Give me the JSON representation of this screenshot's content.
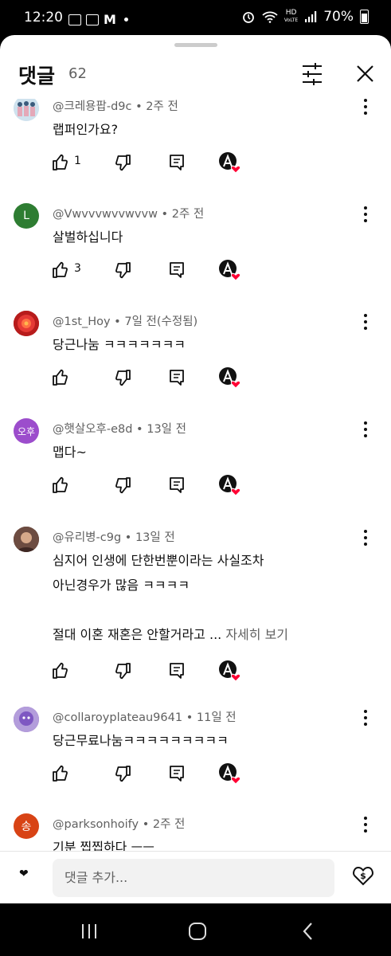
{
  "status_bar": {
    "time": "12:20",
    "battery": "70%",
    "hd_label": "HD",
    "volte_label": "VoLTE"
  },
  "header": {
    "title": "댓글",
    "count": "62"
  },
  "comments": [
    {
      "author": "@크레용팝-d9c",
      "sep": " • ",
      "time": "2주 전",
      "text": "랩퍼인가요?",
      "likes": "1",
      "avatar_letter": ""
    },
    {
      "author": "@Vwvvvwvvwvvw",
      "sep": " • ",
      "time": "2주 전",
      "text": "살벌하십니다",
      "likes": "3",
      "avatar_letter": "L",
      "avatar_color": "#2e7d32"
    },
    {
      "author": "@1st_Hoy",
      "sep": " • ",
      "time": "7일 전(수정됨)",
      "text": "당근나눔 ㅋㅋㅋㅋㅋㅋㅋ",
      "likes": "",
      "avatar_letter": ""
    },
    {
      "author": "@햇살오후-e8d",
      "sep": " • ",
      "time": "13일 전",
      "text": "맵다~",
      "likes": "",
      "avatar_letter": "오후",
      "avatar_color": "#9c4dcc"
    },
    {
      "author": "@유리병-c9g",
      "sep": " • ",
      "time": "13일 전",
      "text": "심지어 인생에 단한번뿐이라는 사실조차\n아닌경우가 많음 ㅋㅋㅋㅋ\n\n절대 이혼 재혼은 안할거라고 ...",
      "more": " 자세히 보기",
      "likes": "",
      "avatar_letter": ""
    },
    {
      "author": "@collaroyplateau9641",
      "sep": " • ",
      "time": "11일 전",
      "text": "당근무료나눔ㅋㅋㅋㅋㅋㅋㅋㅋㅋ",
      "likes": "",
      "avatar_letter": ""
    },
    {
      "author": "@parksonhoify",
      "sep": " • ",
      "time": "2주 전",
      "text": "기분 찝찝하다 ㅡㅡ",
      "likes": "",
      "avatar_letter": "송",
      "avatar_color": "#d84315"
    }
  ],
  "composer": {
    "placeholder": "댓글 추가...",
    "emoji": "❤"
  },
  "colors": {
    "heart": "#ff0033",
    "secondary_text": "#606060"
  }
}
